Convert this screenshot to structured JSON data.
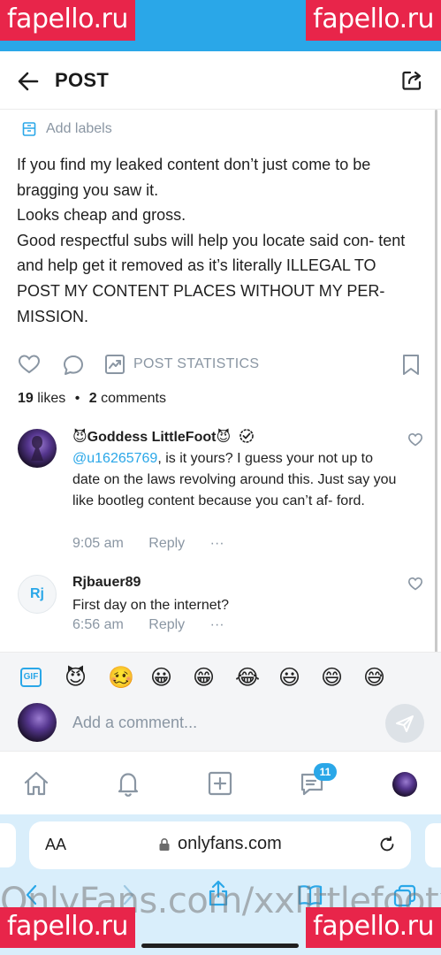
{
  "watermarks": {
    "corner_label": "fapello.ru",
    "bottom_text": "OnlyFans.com/xxlittlefootxx"
  },
  "header": {
    "title": "POST"
  },
  "post": {
    "add_labels": "Add labels",
    "paragraphs": [
      "If you find my leaked content don’t just come to be bragging you saw it.",
      "Looks cheap and gross.",
      "Good respectful subs will help you locate said con- tent and help get it removed as it’s literally ILLEGAL TO POST MY CONTENT PLACES WITHOUT MY PER- MISSION."
    ],
    "statistics_label": "POST STATISTICS",
    "likes_count": "19",
    "likes_label": "likes",
    "comments_count": "2",
    "comments_label": "comments"
  },
  "comments": [
    {
      "author": "😈Goddess LittleFoot😈",
      "mention": "@u16265769",
      "text": ", is it yours? I guess your not up to date on the laws revolving around this. Just say you like bootleg content because you can’t af- ford.",
      "time": "9:05 am",
      "reply_label": "Reply",
      "more": "···"
    },
    {
      "author": "Rjbauer89",
      "avatar_initials": "Rj",
      "text": "First day on the internet?",
      "time": "6:56 am",
      "reply_label": "Reply",
      "more": "···"
    }
  ],
  "emoji_bar": {
    "gif_label": "GIF",
    "emojis": [
      "😈",
      "🥴",
      "😀",
      "😁",
      "😂",
      "😃",
      "😄",
      "😅"
    ]
  },
  "comment_input": {
    "placeholder": "Add a comment..."
  },
  "bottom_nav": {
    "messages_badge": "11",
    "icons": [
      "home-icon",
      "bell-icon",
      "plus-square-icon",
      "messages-icon",
      "profile-avatar"
    ]
  },
  "browser": {
    "text_size": "AA",
    "url": "onlyfans.com"
  },
  "colors": {
    "accent": "#2aa7e8",
    "muted": "#8a96a3",
    "watermark": "#e8254a"
  }
}
